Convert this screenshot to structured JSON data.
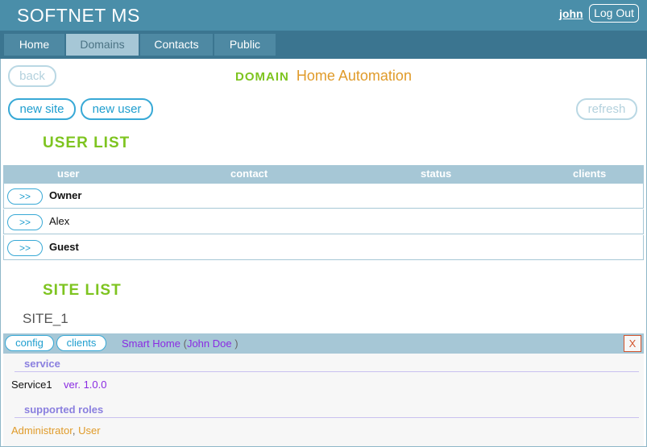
{
  "app": {
    "title": "SOFTNET MS"
  },
  "header": {
    "user": "john",
    "logout_label": "Log Out"
  },
  "nav": {
    "tabs": [
      {
        "label": "Home"
      },
      {
        "label": "Domains"
      },
      {
        "label": "Contacts"
      },
      {
        "label": "Public"
      }
    ],
    "active": "Domains"
  },
  "toolbar": {
    "back_label": "back",
    "new_site_label": "new site",
    "new_user_label": "new user",
    "refresh_label": "refresh"
  },
  "domain": {
    "label": "DOMAIN",
    "name": "Home Automation"
  },
  "user_list": {
    "title": "USER LIST",
    "columns": [
      "user",
      "contact",
      "status",
      "clients"
    ],
    "rows": [
      {
        "button": ">>",
        "name": "Owner"
      },
      {
        "button": ">>",
        "name": "Alex"
      },
      {
        "button": ">>",
        "name": "Guest"
      }
    ]
  },
  "site_list": {
    "title": "SITE LIST",
    "site": {
      "name": "SITE_1",
      "config_label": "config",
      "clients_label": "clients",
      "info_name": "Smart Home",
      "info_paren_open": "(",
      "info_owner": "John Doe",
      "info_paren_close": ")",
      "close_label": "X",
      "service_heading": "service",
      "service_name": "Service1",
      "service_version": "ver. 1.0.0",
      "roles_heading": "supported roles",
      "roles": [
        "Administrator",
        "User"
      ],
      "roles_separator": ","
    }
  }
}
